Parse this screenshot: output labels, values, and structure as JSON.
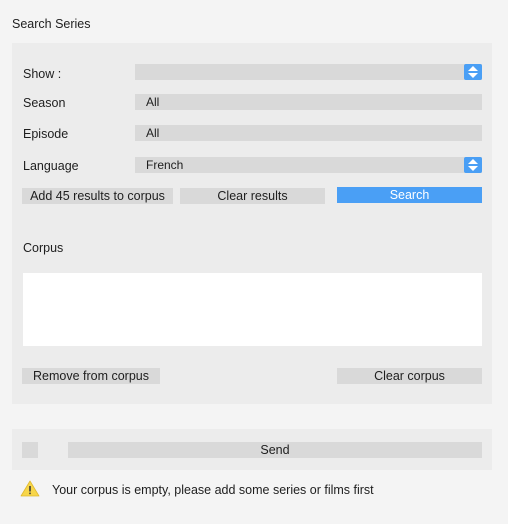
{
  "title": "Search Series",
  "form": {
    "show_label": "Show :",
    "show_value": "",
    "season_label": "Season",
    "season_value": "All",
    "episode_label": "Episode",
    "episode_value": "All",
    "language_label": "Language",
    "language_value": "French"
  },
  "actions": {
    "add_label": "Add 45 results to corpus",
    "clear_results_label": "Clear results",
    "search_label": "Search"
  },
  "corpus": {
    "label": "Corpus",
    "items": [],
    "remove_label": "Remove from corpus",
    "clear_label": "Clear corpus"
  },
  "footer": {
    "send_label": "Send",
    "warning_text": "Your corpus is empty, please add some series or films first"
  },
  "colors": {
    "accent": "#4a9ff5",
    "warning": "#f7d64a",
    "panel": "#ececec",
    "field": "#d9d9d9"
  },
  "icons": [
    "stepper-icon",
    "warning-icon"
  ]
}
